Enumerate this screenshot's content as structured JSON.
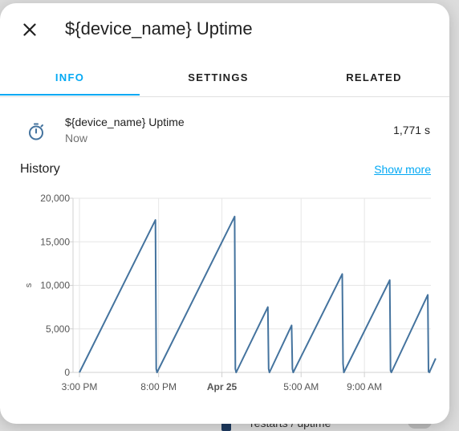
{
  "dialog": {
    "title": "${device_name} Uptime",
    "close_icon": "close-icon"
  },
  "tabs": [
    {
      "label": "INFO",
      "active": true
    },
    {
      "label": "SETTINGS",
      "active": false
    },
    {
      "label": "RELATED",
      "active": false
    }
  ],
  "entity": {
    "icon": "timer-outline-icon",
    "name": "${device_name} Uptime",
    "time": "Now",
    "value": "1,771 s"
  },
  "history": {
    "title": "History",
    "show_more": "Show more"
  },
  "backdrop": {
    "partial_text": "restarts / uptime"
  },
  "colors": {
    "accent": "#03a9f4",
    "series": "#44739e",
    "text": "#212121",
    "secondary_text": "#727272"
  },
  "chart_data": {
    "type": "line",
    "title": "",
    "xlabel": "",
    "ylabel": "s",
    "ylim": [
      0,
      20000
    ],
    "yticks": [
      0,
      5000,
      10000,
      15000,
      20000
    ],
    "ytick_labels": [
      "0",
      "5,000",
      "10,000",
      "15,000",
      "20,000"
    ],
    "x_tick_labels": [
      "3:00 PM",
      "8:00 PM",
      "Apr 25",
      "5:00 AM",
      "9:00 AM"
    ],
    "x_tick_hours": [
      0,
      5,
      9,
      14,
      18
    ],
    "x_range_hours": [
      0,
      22.2
    ],
    "grid": true,
    "series": [
      {
        "points": [
          [
            0.0,
            0
          ],
          [
            4.8,
            17500
          ],
          [
            4.85,
            400
          ],
          [
            4.9,
            0
          ],
          [
            9.8,
            17900
          ],
          [
            9.85,
            400
          ],
          [
            9.9,
            0
          ],
          [
            11.9,
            7500
          ],
          [
            11.95,
            400
          ],
          [
            12.0,
            0
          ],
          [
            13.4,
            5400
          ],
          [
            13.45,
            400
          ],
          [
            13.5,
            0
          ],
          [
            16.6,
            11300
          ],
          [
            16.65,
            1000
          ],
          [
            16.7,
            0
          ],
          [
            19.6,
            10600
          ],
          [
            19.65,
            200
          ],
          [
            19.7,
            0
          ],
          [
            22.0,
            8900
          ],
          [
            22.05,
            100
          ],
          [
            22.1,
            0
          ],
          [
            22.5,
            1600
          ]
        ]
      }
    ]
  }
}
